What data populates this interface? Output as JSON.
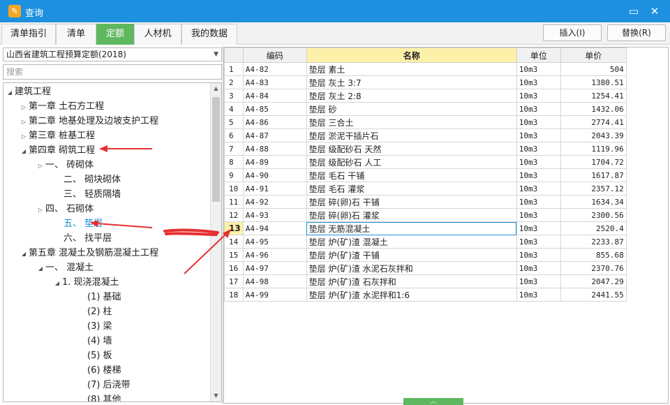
{
  "window": {
    "title": "查询",
    "minimize": "▭",
    "close": "✕"
  },
  "tabs": [
    {
      "label": "清单指引"
    },
    {
      "label": "清单"
    },
    {
      "label": "定额"
    },
    {
      "label": "人材机"
    },
    {
      "label": "我的数据"
    }
  ],
  "actions": {
    "insert": "插入(I)",
    "replace": "替换(R)"
  },
  "left": {
    "quota_library": "山西省建筑工程预算定额(2018)",
    "search_placeholder": "搜索",
    "tree": [
      {
        "label": "建筑工程",
        "toggle": "◢"
      },
      {
        "label": "第一章  土石方工程",
        "toggle": "▷"
      },
      {
        "label": "第二章  地基处理及边坡支护工程",
        "toggle": "▷"
      },
      {
        "label": "第三章  桩基工程",
        "toggle": "▷"
      },
      {
        "label": "第四章  砌筑工程",
        "toggle": "◢"
      },
      {
        "label": "一、  砖砌体",
        "toggle": "▷"
      },
      {
        "label": "二、  砌块砌体",
        "toggle": ""
      },
      {
        "label": "三、  轻质隔墙",
        "toggle": ""
      },
      {
        "label": "四、  石砌体",
        "toggle": "▷"
      },
      {
        "label": "五、  垫层",
        "toggle": ""
      },
      {
        "label": "六、  找平层",
        "toggle": ""
      },
      {
        "label": "第五章  混凝土及钢筋混凝土工程",
        "toggle": "◢"
      },
      {
        "label": "一、  混凝土",
        "toggle": "◢"
      },
      {
        "label": "1. 现浇混凝土",
        "toggle": "◢"
      },
      {
        "label": "(1) 基础",
        "toggle": ""
      },
      {
        "label": "(2) 柱",
        "toggle": ""
      },
      {
        "label": "(3) 梁",
        "toggle": ""
      },
      {
        "label": "(4) 墙",
        "toggle": ""
      },
      {
        "label": "(5) 板",
        "toggle": ""
      },
      {
        "label": "(6) 楼梯",
        "toggle": ""
      },
      {
        "label": "(7) 后浇带",
        "toggle": ""
      },
      {
        "label": "(8) 其他",
        "toggle": ""
      }
    ]
  },
  "grid": {
    "columns": [
      "",
      "编码",
      "名称",
      "单位",
      "单价"
    ],
    "rows": [
      {
        "n": "1",
        "code": "A4-82",
        "name": "垫层 素土",
        "unit": "10m3",
        "price": "504"
      },
      {
        "n": "2",
        "code": "A4-83",
        "name": "垫层 灰土 3:7",
        "unit": "10m3",
        "price": "1380.51"
      },
      {
        "n": "3",
        "code": "A4-84",
        "name": "垫层 灰土 2:8",
        "unit": "10m3",
        "price": "1254.41"
      },
      {
        "n": "4",
        "code": "A4-85",
        "name": "垫层 砂",
        "unit": "10m3",
        "price": "1432.06"
      },
      {
        "n": "5",
        "code": "A4-86",
        "name": "垫层 三合土",
        "unit": "10m3",
        "price": "2774.41"
      },
      {
        "n": "6",
        "code": "A4-87",
        "name": "垫层 淤泥干插片石",
        "unit": "10m3",
        "price": "2043.39"
      },
      {
        "n": "7",
        "code": "A4-88",
        "name": "垫层 级配砂石 天然",
        "unit": "10m3",
        "price": "1119.96"
      },
      {
        "n": "8",
        "code": "A4-89",
        "name": "垫层 级配砂石 人工",
        "unit": "10m3",
        "price": "1704.72"
      },
      {
        "n": "9",
        "code": "A4-90",
        "name": "垫层 毛石 干铺",
        "unit": "10m3",
        "price": "1617.87"
      },
      {
        "n": "10",
        "code": "A4-91",
        "name": "垫层 毛石 灌浆",
        "unit": "10m3",
        "price": "2357.12"
      },
      {
        "n": "11",
        "code": "A4-92",
        "name": "垫层 碎(卵)石 干铺",
        "unit": "10m3",
        "price": "1634.34"
      },
      {
        "n": "12",
        "code": "A4-93",
        "name": "垫层 碎(卵)石 灌浆",
        "unit": "10m3",
        "price": "2300.56"
      },
      {
        "n": "13",
        "code": "A4-94",
        "name": "垫层 无筋混凝土",
        "unit": "10m3",
        "price": "2520.4"
      },
      {
        "n": "14",
        "code": "A4-95",
        "name": "垫层 炉(矿)渣 混凝土",
        "unit": "10m3",
        "price": "2233.87"
      },
      {
        "n": "15",
        "code": "A4-96",
        "name": "垫层 炉(矿)渣 干铺",
        "unit": "10m3",
        "price": "855.68"
      },
      {
        "n": "16",
        "code": "A4-97",
        "name": "垫层 炉(矿)渣 水泥石灰拌和",
        "unit": "10m3",
        "price": "2370.76"
      },
      {
        "n": "17",
        "code": "A4-98",
        "name": "垫层 炉(矿)渣 石灰拌和",
        "unit": "10m3",
        "price": "2047.29"
      },
      {
        "n": "18",
        "code": "A4-99",
        "name": "垫层 炉(矿)渣 水泥拌和1:6",
        "unit": "10m3",
        "price": "2441.55"
      }
    ]
  },
  "colors": {
    "titlebar": "#1e90e0",
    "active_tab": "#5fb85f",
    "selected_tree": "#1e8fd8",
    "header_highlight": "#fdf0a8",
    "annotation": "#e53030"
  }
}
